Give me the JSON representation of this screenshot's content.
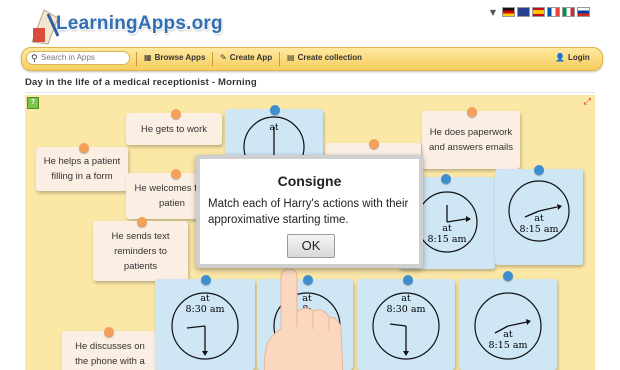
{
  "header": {
    "logo_text": "LearningApps.org",
    "languages": [
      "de",
      "en",
      "es",
      "fr",
      "it",
      "ru"
    ]
  },
  "toolbar": {
    "search_placeholder": "Search in Apps",
    "browse_label": "Browse Apps",
    "create_label": "Create App",
    "collection_label": "Create collection",
    "login_label": "Login"
  },
  "page": {
    "title": "Day in the life of a medical receptionist - Morning"
  },
  "cards": [
    {
      "text": "He gets to work"
    },
    {
      "text": "He helps a patient filling in a form"
    },
    {
      "text": "He welcomes first patien"
    },
    {
      "text": "He sends text reminders to patients"
    },
    {
      "text": "He does paperwork and answers emails"
    },
    {
      "text": "He discusses on the phone with a"
    }
  ],
  "clocks": [
    {
      "prefix": "at",
      "time": ""
    },
    {
      "prefix": "at",
      "time": "8:15 am"
    },
    {
      "prefix": "at",
      "time": "8:15 am"
    },
    {
      "prefix": "at",
      "time": "8:30 am"
    },
    {
      "prefix": "at",
      "time": "8:"
    },
    {
      "prefix": "at",
      "time": "8:30 am"
    },
    {
      "prefix": "at",
      "time": "8:15 am"
    }
  ],
  "dialog": {
    "title": "Consigne",
    "text": "Match each of Harry's actions with their approximative starting time.",
    "ok_label": "OK"
  },
  "colors": {
    "accent": "#2f6fb3",
    "toolbar": "#f6cd5e",
    "app_bg": "#fbe7a6",
    "card": "#fbeee2",
    "clock_card": "#cfe6f5"
  }
}
